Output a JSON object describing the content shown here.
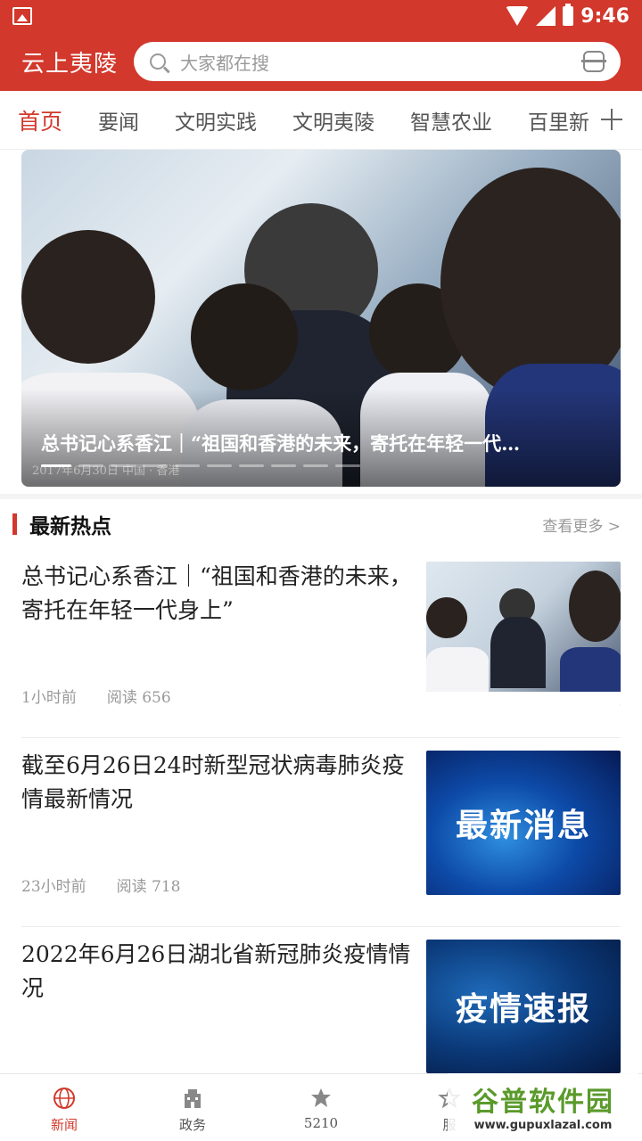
{
  "status_bar": {
    "time": "9:46",
    "battery": "9"
  },
  "header": {
    "app_title": "云上夷陵",
    "search_placeholder": "大家都在搜"
  },
  "tabs": [
    "首页",
    "要闻",
    "文明实践",
    "文明夷陵",
    "智慧农业",
    "百里新"
  ],
  "banner": {
    "title": "总书记心系香江｜“祖国和香港的未来，寄托在年轻一代…",
    "caption": "2017年6月30日  中国 · 香港"
  },
  "section": {
    "title": "最新热点",
    "more": "查看更多 >"
  },
  "news": [
    {
      "title": "总书记心系香江｜“祖国和香港的未来，寄托在年轻一代身上”",
      "time": "1小时前",
      "reads": "阅读  656"
    },
    {
      "title": "截至6月26日24时新型冠状病毒肺炎疫情最新情况",
      "time": "23小时前",
      "reads": "阅读  718",
      "thumb_text": "最新消息"
    },
    {
      "title": "2022年6月26日湖北省新冠肺炎疫情情况",
      "time": "",
      "reads": "",
      "thumb_text": "疫情速报"
    }
  ],
  "bottom_nav": [
    "新闻",
    "政务",
    "5210",
    "服"
  ],
  "watermark": {
    "main": "谷普软件园",
    "url": "www.gupuxlazal.com"
  },
  "colors": {
    "brand": "#d2382c"
  }
}
